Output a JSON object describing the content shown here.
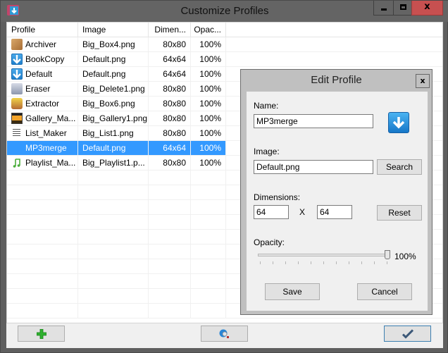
{
  "window": {
    "title": "Customize Profiles",
    "controls": [
      "minimize",
      "maximize",
      "close"
    ],
    "close_glyph": "x"
  },
  "list": {
    "columns": [
      "Profile",
      "Image",
      "Dimen...",
      "Opac..."
    ],
    "rows": [
      {
        "profile": "Archiver",
        "image": "Big_Box4.png",
        "dimensions": "80x80",
        "opacity": "100%",
        "icon": "box-icon"
      },
      {
        "profile": "BookCopy",
        "image": "Default.png",
        "dimensions": "64x64",
        "opacity": "100%",
        "icon": "download-arrow-icon"
      },
      {
        "profile": "Default",
        "image": "Default.png",
        "dimensions": "64x64",
        "opacity": "100%",
        "icon": "download-arrow-icon"
      },
      {
        "profile": "Eraser",
        "image": "Big_Delete1.png",
        "dimensions": "80x80",
        "opacity": "100%",
        "icon": "eraser-icon"
      },
      {
        "profile": "Extractor",
        "image": "Big_Box6.png",
        "dimensions": "80x80",
        "opacity": "100%",
        "icon": "open-box-icon"
      },
      {
        "profile": "Gallery_Ma...",
        "image": "Big_Gallery1.png",
        "dimensions": "80x80",
        "opacity": "100%",
        "icon": "gallery-icon"
      },
      {
        "profile": "List_Maker",
        "image": "Big_List1.png",
        "dimensions": "80x80",
        "opacity": "100%",
        "icon": "list-icon"
      },
      {
        "profile": "MP3merge",
        "image": "Default.png",
        "dimensions": "64x64",
        "opacity": "100%",
        "icon": "download-arrow-icon",
        "selected": true
      },
      {
        "profile": "Playlist_Ma...",
        "image": "Big_Playlist1.p...",
        "dimensions": "80x80",
        "opacity": "100%",
        "icon": "music-note-icon"
      }
    ]
  },
  "bottom_bar": {
    "add_button": "add-icon",
    "web_button": "globe-search-icon",
    "ok_button": "checkmark-icon"
  },
  "dialog": {
    "title": "Edit Profile",
    "close_glyph": "x",
    "name_label": "Name:",
    "name_value": "MP3merge",
    "image_label": "Image:",
    "image_value": "Default.png",
    "search_label": "Search",
    "dimensions_label": "Dimensions:",
    "width_value": "64",
    "x_label": "X",
    "height_value": "64",
    "reset_label": "Reset",
    "opacity_label": "Opacity:",
    "opacity_value_text": "100%",
    "opacity_fraction": 1.0,
    "save_label": "Save",
    "cancel_label": "Cancel"
  }
}
